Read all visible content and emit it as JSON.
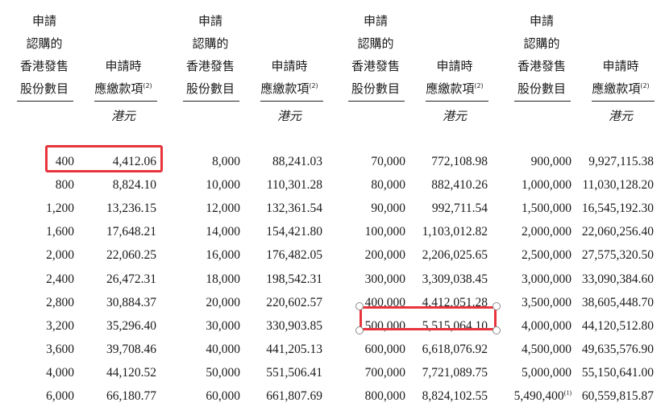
{
  "headers": {
    "shares": [
      "申請",
      "認購的",
      "香港發售",
      "股份數目"
    ],
    "amount_line1": "申請時",
    "amount_line2": "應繳款項",
    "amount_note": "(2)",
    "currency": "港元"
  },
  "columns": [
    {
      "shares": [
        "400",
        "800",
        "1,200",
        "1,600",
        "2,000",
        "2,400",
        "2,800",
        "3,200",
        "3,600",
        "4,000",
        "6,000"
      ],
      "amounts": [
        "4,412.06",
        "8,824.10",
        "13,236.15",
        "17,648.21",
        "22,060.25",
        "26,472.31",
        "30,884.37",
        "35,296.40",
        "39,708.46",
        "44,120.52",
        "66,180.77"
      ]
    },
    {
      "shares": [
        "8,000",
        "10,000",
        "12,000",
        "14,000",
        "16,000",
        "18,000",
        "20,000",
        "30,000",
        "40,000",
        "50,000",
        "60,000"
      ],
      "amounts": [
        "88,241.03",
        "110,301.28",
        "132,361.54",
        "154,421.80",
        "176,482.05",
        "198,542.31",
        "220,602.57",
        "330,903.85",
        "441,205.13",
        "551,506.41",
        "661,807.69"
      ]
    },
    {
      "shares": [
        "70,000",
        "80,000",
        "90,000",
        "100,000",
        "200,000",
        "300,000",
        "400,000",
        "500,000",
        "600,000",
        "700,000",
        "800,000"
      ],
      "amounts": [
        "772,108.98",
        "882,410.26",
        "992,711.54",
        "1,103,012.82",
        "2,206,025.65",
        "3,309,038.45",
        "4,412,051.28",
        "5,515,064.10",
        "6,618,076.92",
        "7,721,089.75",
        "8,824,102.55"
      ]
    },
    {
      "shares": [
        "900,000",
        "1,000,000",
        "1,500,000",
        "2,000,000",
        "2,500,000",
        "3,000,000",
        "3,500,000",
        "4,000,000",
        "4,500,000",
        "5,000,000",
        "5,490,400"
      ],
      "amounts": [
        "9,927,115.38",
        "11,030,128.20",
        "16,545,192.30",
        "22,060,256.40",
        "27,575,320.50",
        "33,090,384.60",
        "38,605,448.70",
        "44,120,512.80",
        "49,635,576.90",
        "55,150,641.00",
        "60,559,815.87"
      ]
    }
  ],
  "last_row_note": "(1)",
  "highlight_color": "#e8343c"
}
